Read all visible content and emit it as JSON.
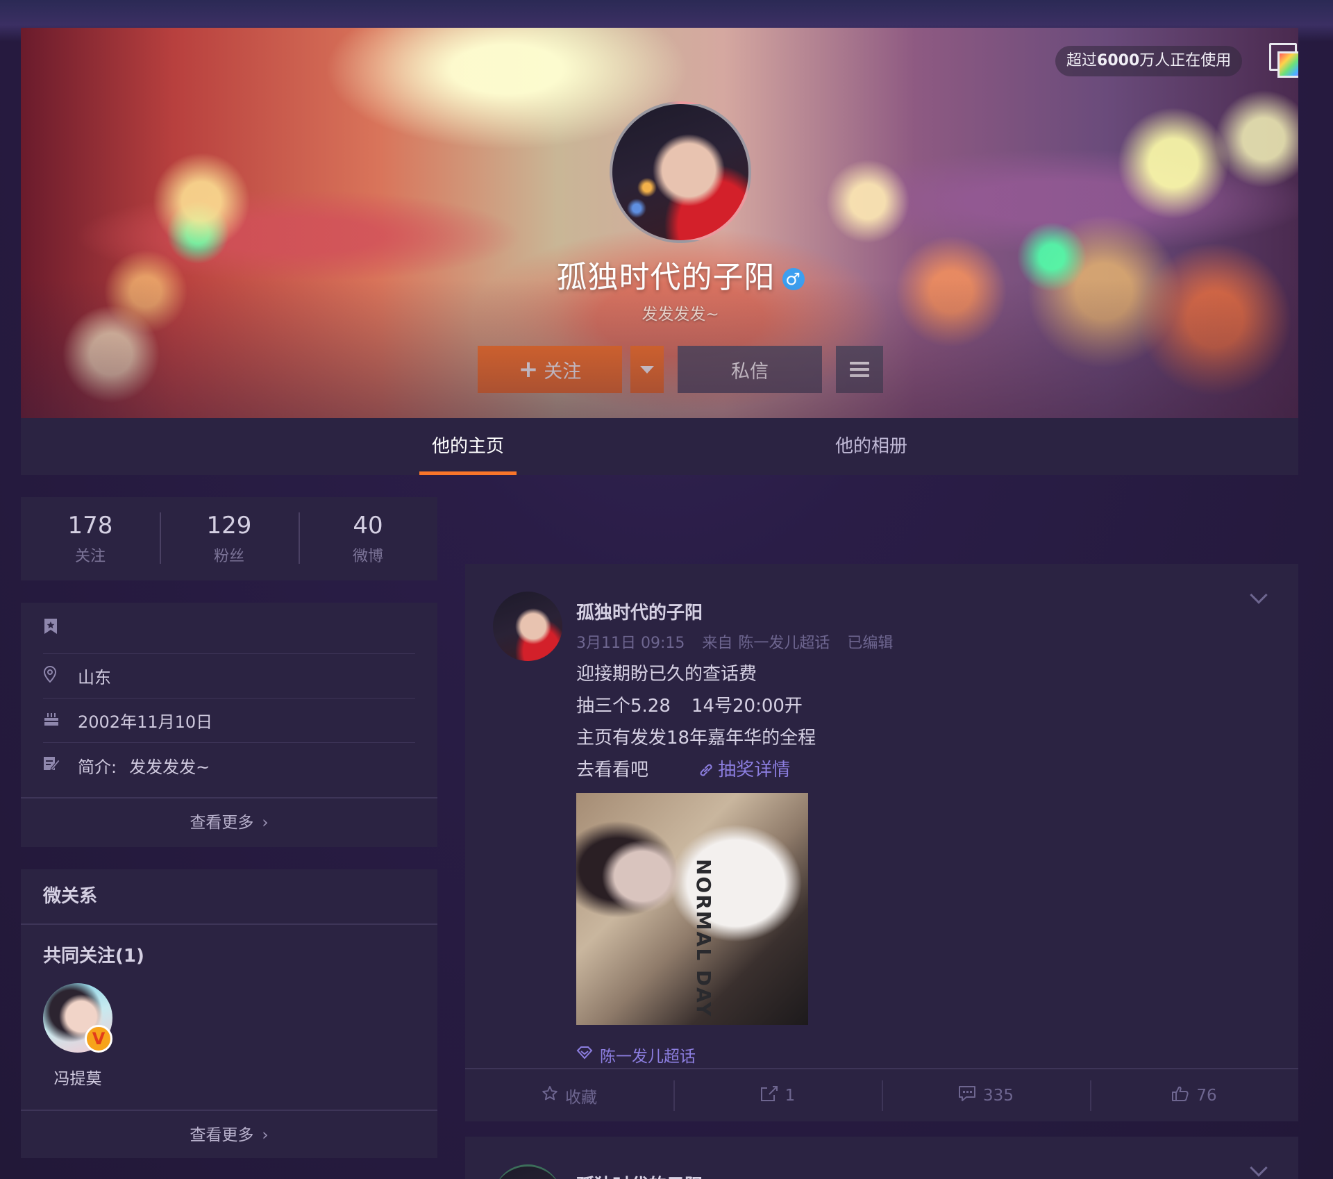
{
  "banner": {
    "users_badge_prefix": "超过",
    "users_badge_count": "6000",
    "users_badge_suffix": "万人正在使用"
  },
  "profile": {
    "name": "孤独时代的子阳",
    "gender_symbol": "♂",
    "bio": "发发发发~",
    "follow_label": "关注",
    "message_label": "私信"
  },
  "tabs": [
    {
      "label": "他的主页",
      "active": true
    },
    {
      "label": "他的相册",
      "active": false
    }
  ],
  "stats": [
    {
      "value": "178",
      "label": "关注"
    },
    {
      "value": "129",
      "label": "粉丝"
    },
    {
      "value": "40",
      "label": "微博"
    }
  ],
  "info": {
    "location": "山东",
    "birthday": "2002年11月10日",
    "intro_key": "简介:",
    "intro_value": "发发发发~",
    "more_label": "查看更多"
  },
  "relations": {
    "title": "微关系",
    "common_label": "共同关注(1)",
    "friends": [
      {
        "name": "冯提莫"
      }
    ],
    "badge": "V",
    "more_label": "查看更多"
  },
  "feed": {
    "user": "孤独时代的子阳",
    "time": "3月11日 09:15",
    "source_prefix": "来自",
    "source": "陈一发儿超话",
    "edited": "已编辑",
    "lines": [
      "迎接期盼已久的查话费",
      "抽三个5.28",
      "14号20:00开",
      "主页有发发18年嘉年华的全程",
      "去看看吧"
    ],
    "link_label": "抽奖详情",
    "image_text": "NORMAL DAY",
    "topic": "陈一发儿超话",
    "actions": {
      "favorite": "收藏",
      "repost": "1",
      "comment": "335",
      "like": "76"
    }
  },
  "feed2": {
    "user": "孤独时代的子阳"
  },
  "colors": {
    "accent": "#f9752a",
    "card_bg": "#2b2342",
    "link": "#8c7ee0",
    "gender": "#3c9ff0"
  },
  "icons": {
    "skin": "skin-icon",
    "gender": "male-icon",
    "dropdown": "caret-down-icon",
    "menu": "menu-icon",
    "bookmark": "bookmark-icon",
    "location": "location-pin-icon",
    "birthday": "cake-icon",
    "intro": "edit-icon",
    "chevron": "chevron-right-icon",
    "link": "link-icon",
    "topic": "diamond-icon",
    "favorite": "star-icon",
    "repost": "share-icon",
    "comment": "comment-icon",
    "like": "thumbs-up-icon"
  }
}
